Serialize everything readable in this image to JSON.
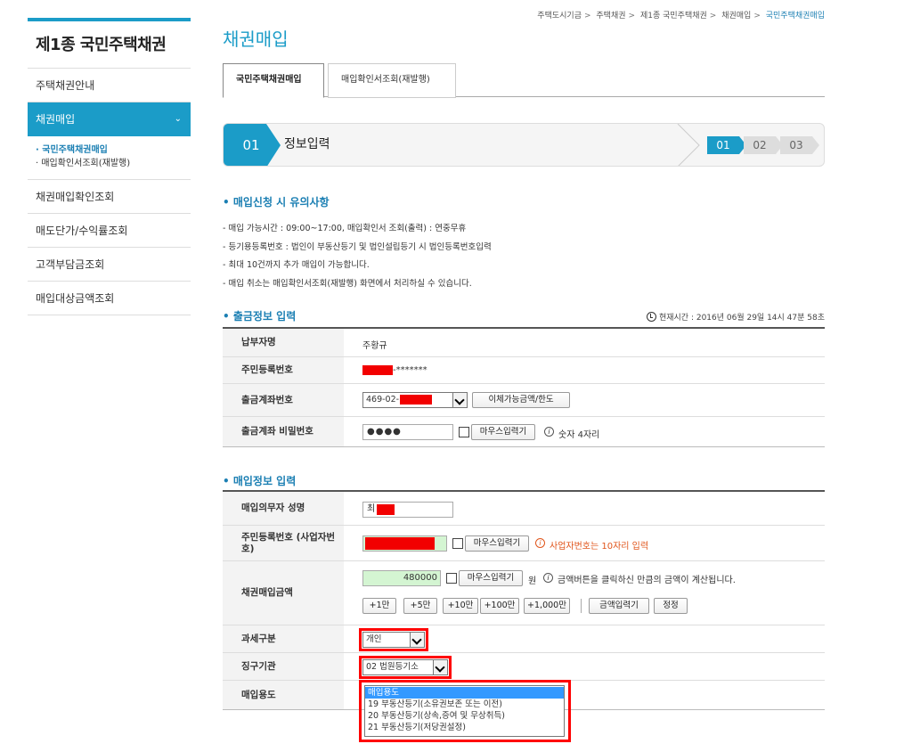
{
  "sidebar": {
    "title": "제1종 국민주택채권",
    "items": [
      {
        "label": "주택채권안내"
      },
      {
        "label": "채권매입",
        "active": true
      }
    ],
    "subitems": [
      {
        "label": "· 국민주택채권매입",
        "current": true
      },
      {
        "label": "· 매입확인서조회(재발행)"
      }
    ],
    "items_after": [
      {
        "label": "채권매입확인조회"
      },
      {
        "label": "매도단가/수익률조회"
      },
      {
        "label": "고객부담금조회"
      },
      {
        "label": "매입대상금액조회"
      }
    ],
    "chevron": "chevron-down-icon"
  },
  "breadcrumb": [
    "주택도시기금",
    "주택채권",
    "제1종 국민주택채권",
    "채권매입",
    "국민주택채권매입"
  ],
  "page_title": "채권매입",
  "tabs": [
    {
      "label": "국민주택채권매입",
      "active": true
    },
    {
      "label": "매입확인서조회(재발행)"
    }
  ],
  "stepbar": {
    "current_num": "01",
    "current_label": "정보입력",
    "steps": [
      "01",
      "02",
      "03"
    ]
  },
  "notice": {
    "title": "• 매입신청 시 유의사항",
    "lines": [
      "- 매입 가능시간 : 09:00~17:00, 매입확인서 조회(출력) : 연중무휴",
      "- 등기용등록번호 : 법인이 부동산등기 및 법인설립등기 시 법인등록번호입력",
      "- 최대 10건까지 추가 매입이 가능합니다.",
      "- 매입 취소는 매입확인서조회(재발행) 화면에서 처리하실 수 있습니다."
    ]
  },
  "withdraw": {
    "title": "• 출금정보 입력",
    "current_time": "현재시간 : 2016년 06월 29일 14시 47분 58초",
    "payer_label": "납부자명",
    "payer_value": "주황규",
    "rrn_label": "주민등록번호",
    "rrn_masked": "-*******",
    "account_label": "출금계좌번호",
    "account_prefix": "469-02-",
    "account_button": "이체가능금액/한도",
    "password_label": "출금계좌 비밀번호",
    "password_value": "●●●●",
    "mouse_input": "마우스입력기",
    "password_hint": "숫자 4자리"
  },
  "purchase": {
    "title": "• 매입정보 입력",
    "name_label": "매입의무자 성명",
    "name_prefix": "최",
    "rrn_label": "주민등록번호 (사업자번호)",
    "mouse_input": "마우스입력기",
    "biz_hint": "사업자번호는 10자리 입력",
    "amount_label": "채권매입금액",
    "amount_value": "480000",
    "amount_unit": "원",
    "amount_hint": "금액버튼을 클릭하신 만큼의 금액이 계산됩니다.",
    "amount_buttons": [
      "+1만",
      "+5만",
      "+10만",
      "+100만",
      "+1,000만"
    ],
    "amount_input_button": "금액입력기",
    "amount_reset_button": "정정",
    "tax_label": "과세구분",
    "tax_value": "개인",
    "agency_label": "징구기관",
    "agency_value": "02 법원등기소",
    "usage_label": "매입용도",
    "usage_options": [
      "매입용도",
      "19 부동산등기(소유권보존 또는 이전)",
      "20 부동산등기(상속,증여 및 무상취득)",
      "21 부동산등기(저당권설정)"
    ]
  },
  "colors": {
    "accent": "#1b9cc8",
    "highlight": "#ff0000",
    "redaction": "#f20000",
    "input_green": "#d4f5d2"
  }
}
